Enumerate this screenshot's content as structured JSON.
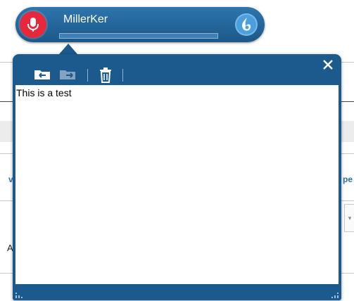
{
  "voice_bar": {
    "user_name": "MillerKer",
    "level": 0
  },
  "dictation_box": {
    "text": "This is a test",
    "toolbar": {
      "icons": [
        "transfer-icon",
        "transfer-disabled-icon",
        "trash-icon"
      ]
    }
  },
  "background_page": {
    "left_fragment": "v",
    "right_fragment": "pe",
    "row_fragment": "A"
  },
  "colors": {
    "panel": "#1c5a8e",
    "mic": "#e8283a",
    "dragon": "#4aa0dc"
  }
}
